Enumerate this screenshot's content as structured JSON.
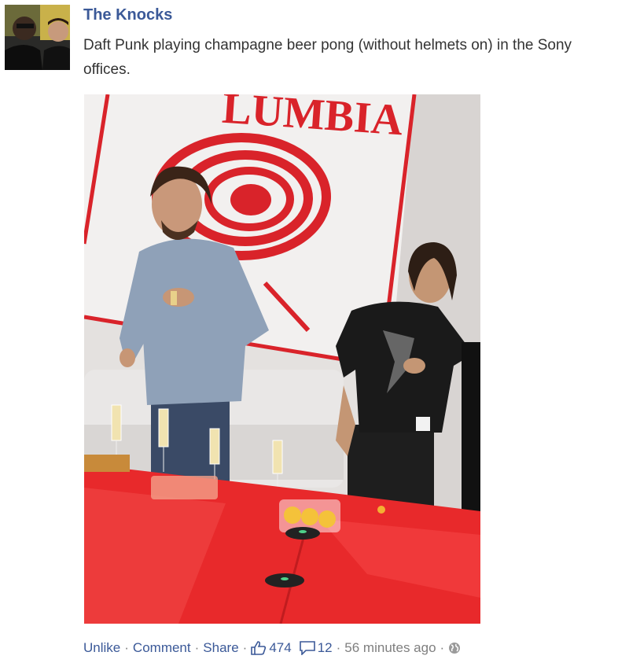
{
  "post": {
    "author": "The Knocks",
    "text": "Daft Punk playing champagne beer pong (without helmets on) in the Sony offices.",
    "photo": {
      "sign_text": "LUMBIA",
      "icons": [
        "avatar-photo"
      ]
    }
  },
  "actions": {
    "unlike": "Unlike",
    "comment": "Comment",
    "share": "Share",
    "separator": "·",
    "likes_count": "474",
    "comments_count": "12",
    "timestamp": "56 minutes ago"
  },
  "icons": {
    "like": "thumbs-up-icon",
    "comment": "speech-bubble-icon",
    "privacy": "globe-icon"
  },
  "colors": {
    "link": "#3b5998",
    "text": "#333333",
    "muted": "#7f7f7f",
    "table_red": "#e8292b",
    "logo_red": "#d9232a"
  }
}
